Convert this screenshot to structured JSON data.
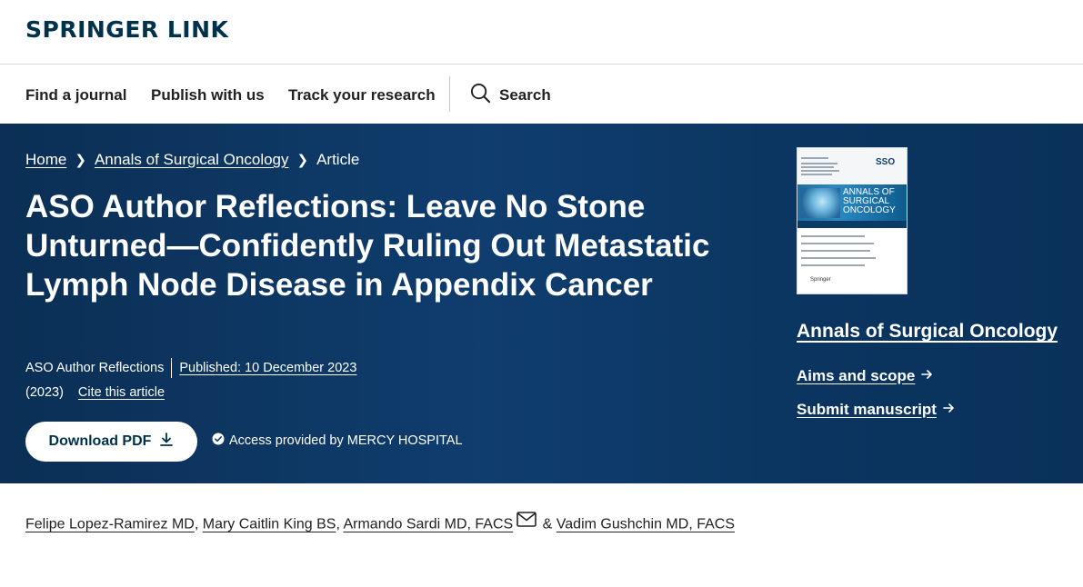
{
  "header": {
    "logo": "SPRINGER LINK"
  },
  "nav": {
    "find_journal": "Find a journal",
    "publish": "Publish with us",
    "track": "Track your research",
    "search": "Search"
  },
  "breadcrumb": {
    "home": "Home",
    "journal": "Annals of Surgical Oncology",
    "current": "Article"
  },
  "article": {
    "title": "ASO Author Reflections: Leave No Stone Unturned—Confidently Ruling Out Metastatic Lymph Node Disease in Appendix Cancer",
    "type": "ASO Author Reflections",
    "published": "Published: 10 December 2023",
    "year": "(2023)",
    "cite": "Cite this article",
    "download": "Download PDF",
    "access": "Access provided by MERCY HOSPITAL"
  },
  "sidebar": {
    "cover_journal_line1": "ANNALS OF",
    "cover_journal_line2": "SURGICAL",
    "cover_journal_line3": "ONCOLOGY",
    "cover_sso": "SSO",
    "cover_publisher": "Springer",
    "journal_title": "Annals of Surgical Oncology",
    "aims": "Aims and scope",
    "submit": "Submit manuscript"
  },
  "authors": {
    "a1": "Felipe Lopez-Ramirez MD",
    "a2": "Mary Caitlin King BS",
    "a3": "Armando Sardi MD, FACS",
    "amp": "&",
    "a4": "Vadim Gushchin MD, FACS"
  },
  "colors": {
    "brand_dark": "#01324b",
    "hero_bg": "#0f3d6e"
  }
}
